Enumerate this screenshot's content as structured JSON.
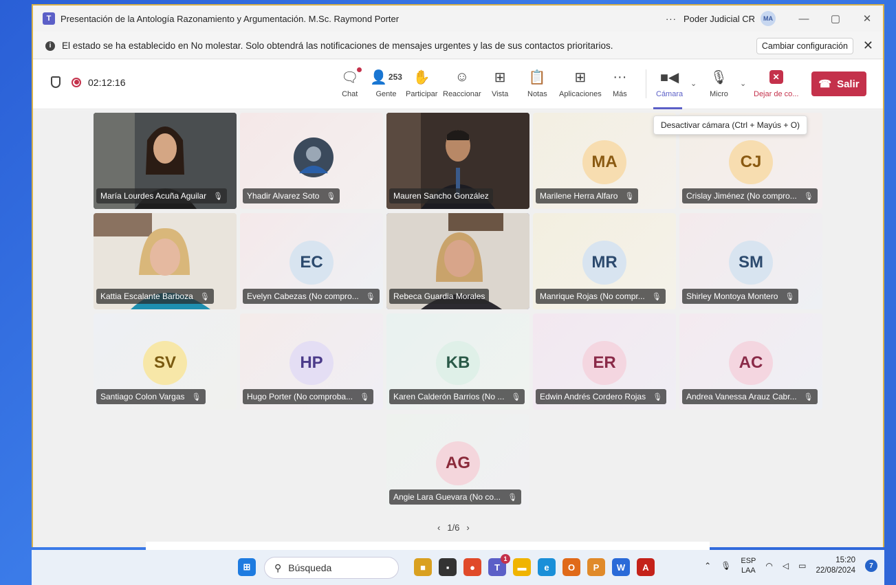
{
  "window": {
    "title": "Presentación de la Antología Razonamiento y Argumentación. M.Sc. Raymond Porter",
    "org": "Poder Judicial CR",
    "org_dots": "···",
    "user_initials": "MA",
    "controls": {
      "minimize": "—",
      "maximize": "▢",
      "close": "✕"
    }
  },
  "notification": {
    "text": "El estado se ha establecido en No molestar. Solo obtendrá las notificaciones de mensajes urgentes y las de sus contactos prioritarios.",
    "button": "Cambiar configuración",
    "close": "✕"
  },
  "toolbar": {
    "timer": "02:12:16",
    "people_count": "253",
    "chat": "Chat",
    "people": "Gente",
    "raise": "Participar",
    "react": "Reaccionar",
    "view": "Vista",
    "notes": "Notas",
    "apps": "Aplicaciones",
    "more": "Más",
    "camera": "Cámara",
    "mic": "Micro",
    "stop_share": "Dejar de co...",
    "leave": "Salir",
    "tooltip": "Desactivar cámara (Ctrl + Mayús + O)"
  },
  "participants": [
    {
      "name": "María Lourdes Acuña Aguilar",
      "initials": "",
      "video": true
    },
    {
      "name": "Yhadir Alvarez Soto",
      "initials": "",
      "video": false
    },
    {
      "name": "Mauren Sancho González",
      "initials": "",
      "video": true
    },
    {
      "name": "Marilene Herra Alfaro",
      "initials": "MA",
      "video": false
    },
    {
      "name": "Crislay Jiménez (No compro...",
      "initials": "CJ",
      "video": false
    },
    {
      "name": "Kattia Escalante Barboza",
      "initials": "",
      "video": true
    },
    {
      "name": "Evelyn Cabezas (No compro...",
      "initials": "EC",
      "video": false
    },
    {
      "name": "Rebeca Guardia Morales",
      "initials": "",
      "video": true
    },
    {
      "name": "Manrique Rojas (No compr...",
      "initials": "MR",
      "video": false
    },
    {
      "name": "Shirley Montoya Montero",
      "initials": "SM",
      "video": false
    },
    {
      "name": "Santiago Colon Vargas",
      "initials": "SV",
      "video": false
    },
    {
      "name": "Hugo Porter (No comproba...",
      "initials": "HP",
      "video": false
    },
    {
      "name": "Karen Calderón Barrios (No ...",
      "initials": "KB",
      "video": false
    },
    {
      "name": "Edwin Andrés Cordero Rojas",
      "initials": "ER",
      "video": false
    },
    {
      "name": "Andrea Vanessa Arauz Cabr...",
      "initials": "AC",
      "video": false
    },
    {
      "name": "Angie Lara Guevara (No co...",
      "initials": "AG",
      "video": false
    }
  ],
  "pager": {
    "prev": "‹",
    "label": "1/6",
    "next": "›"
  },
  "taskbar": {
    "search": "Búsqueda",
    "lang_top": "ESP",
    "lang_bottom": "LAA",
    "time": "15:20",
    "date": "22/08/2024",
    "notifications": "7",
    "teams_badge": "1"
  },
  "colors": {
    "accent": "#5b5fc7",
    "leave": "#c4314b"
  }
}
